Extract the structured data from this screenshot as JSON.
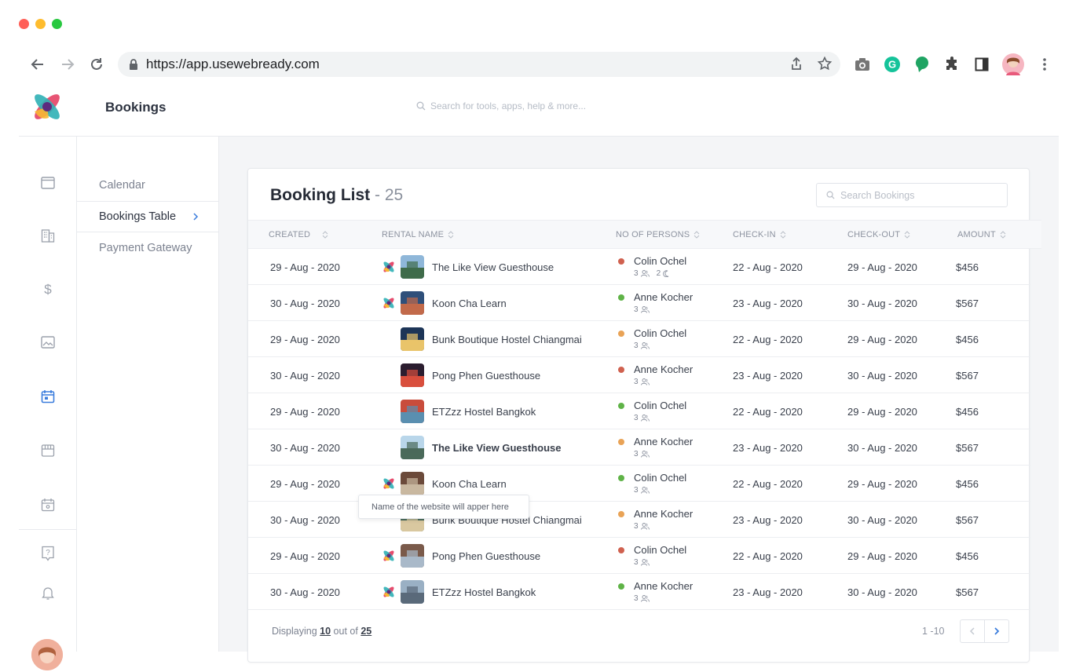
{
  "browser": {
    "url": "https://app.usewebready.com"
  },
  "header": {
    "title": "Bookings",
    "search_placeholder": "Search for tools, apps, help & more..."
  },
  "subnav": {
    "items": [
      {
        "label": "Calendar"
      },
      {
        "label": "Bookings Table"
      },
      {
        "label": "Payment Gateway"
      }
    ]
  },
  "card": {
    "title": "Booking List",
    "count": "- 25",
    "search_placeholder": "Search Bookings"
  },
  "table": {
    "headers": {
      "created": "CREATED",
      "rental": "RENTAL NAME",
      "persons": "NO OF PERSONS",
      "checkin": "CHECK-IN",
      "checkout": "CHECK-OUT",
      "amount": "AMOUNT"
    },
    "rows": [
      {
        "created": "29 - Aug - 2020",
        "rental": "The Like View Guesthouse",
        "person": "Colin Ochel",
        "guests": "3",
        "nights": "2",
        "checkin": "22 - Aug - 2020",
        "checkout": "29 - Aug - 2020",
        "amount": "$456"
      },
      {
        "created": "30 - Aug - 2020",
        "rental": "Koon Cha Learn",
        "person": "Anne Kocher",
        "guests": "3",
        "checkin": "23 - Aug - 2020",
        "checkout": "30 - Aug - 2020",
        "amount": "$567"
      },
      {
        "created": "29 - Aug - 2020",
        "rental": "Bunk Boutique Hostel Chiangmai",
        "person": "Colin Ochel",
        "guests": "3",
        "checkin": "22 - Aug - 2020",
        "checkout": "29 - Aug - 2020",
        "amount": "$456"
      },
      {
        "created": "30 - Aug - 2020",
        "rental": "Pong Phen Guesthouse",
        "person": "Anne Kocher",
        "guests": "3",
        "checkin": "23 - Aug - 2020",
        "checkout": "30 - Aug - 2020",
        "amount": "$567"
      },
      {
        "created": "29 - Aug - 2020",
        "rental": "ETZzz Hostel Bangkok",
        "person": "Colin Ochel",
        "guests": "3",
        "checkin": "22 - Aug - 2020",
        "checkout": "29 - Aug - 2020",
        "amount": "$456"
      },
      {
        "created": "30 - Aug - 2020",
        "rental": "The Like View Guesthouse",
        "person": "Anne Kocher",
        "guests": "3",
        "checkin": "23 - Aug - 2020",
        "checkout": "30 - Aug - 2020",
        "amount": "$567"
      },
      {
        "created": "29 - Aug - 2020",
        "rental": "Koon Cha Learn",
        "person": "Colin Ochel",
        "guests": "3",
        "checkin": "22 - Aug - 2020",
        "checkout": "29 - Aug - 2020",
        "amount": "$456"
      },
      {
        "created": "30 - Aug - 2020",
        "rental": "Bunk Boutique Hostel Chiangmai",
        "person": "Anne Kocher",
        "guests": "3",
        "checkin": "23 - Aug - 2020",
        "checkout": "30 - Aug - 2020",
        "amount": "$567"
      },
      {
        "created": "29 - Aug - 2020",
        "rental": "Pong Phen Guesthouse",
        "person": "Colin Ochel",
        "guests": "3",
        "checkin": "22 - Aug - 2020",
        "checkout": "29 - Aug - 2020",
        "amount": "$456"
      },
      {
        "created": "30 - Aug - 2020",
        "rental": "ETZzz Hostel Bangkok",
        "person": "Anne Kocher",
        "guests": "3",
        "checkin": "23 - Aug - 2020",
        "checkout": "30 - Aug - 2020",
        "amount": "$567"
      }
    ]
  },
  "tooltip": {
    "text": "Name of the website will apper here"
  },
  "footer": {
    "displaying_prefix": "Displaying",
    "shown": "10",
    "out_of": "out of",
    "total": "25",
    "range": "1 -10"
  },
  "colors": {
    "accent": "#3b7ddd",
    "status_red": "#d0614f",
    "status_green": "#5fb347",
    "status_orange": "#e9a356"
  },
  "icons": {
    "rail": [
      "browser-window-icon",
      "building-icon",
      "dollar-icon",
      "image-icon",
      "calendar-icon",
      "store-icon",
      "calendar-event-icon",
      "help-icon",
      "bell-icon"
    ]
  }
}
